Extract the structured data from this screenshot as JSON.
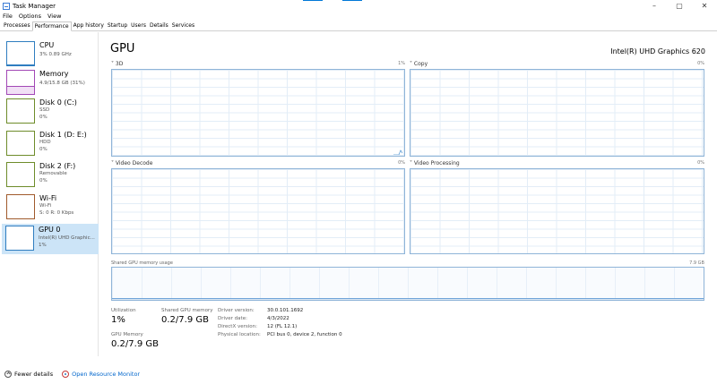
{
  "window": {
    "title": "Task Manager",
    "controls": {
      "minimize": "–",
      "maximize": "▢",
      "close": "✕"
    }
  },
  "menu": [
    "File",
    "Options",
    "View"
  ],
  "tabs": [
    {
      "label": "Processes",
      "active": false
    },
    {
      "label": "Performance",
      "active": true
    },
    {
      "label": "App history",
      "active": false
    },
    {
      "label": "Startup",
      "active": false
    },
    {
      "label": "Users",
      "active": false
    },
    {
      "label": "Details",
      "active": false
    },
    {
      "label": "Services",
      "active": false
    }
  ],
  "sidebar": {
    "items": [
      {
        "title": "CPU",
        "lines": [
          "3%  0.89 GHz"
        ]
      },
      {
        "title": "Memory",
        "lines": [
          "4.9/15.8 GB (31%)"
        ]
      },
      {
        "title": "Disk 0 (C:)",
        "lines": [
          "SSD",
          "0%"
        ]
      },
      {
        "title": "Disk 1 (D: E:)",
        "lines": [
          "HDD",
          "0%"
        ]
      },
      {
        "title": "Disk 2 (F:)",
        "lines": [
          "Removable",
          "0%"
        ]
      },
      {
        "title": "Wi-Fi",
        "lines": [
          "Wi-Fi",
          "S: 0  R: 0 Kbps"
        ]
      },
      {
        "title": "GPU 0",
        "lines": [
          "Intel(R) UHD Graphic...",
          "1%"
        ],
        "selected": true
      }
    ]
  },
  "main": {
    "title": "GPU",
    "model": "Intel(R) UHD Graphics 620",
    "graphs": [
      {
        "label": "3D",
        "right": "1%"
      },
      {
        "label": "Copy",
        "right": "0%"
      },
      {
        "label": "Video Decode",
        "right": "0%"
      },
      {
        "label": "Video Processing",
        "right": "0%"
      }
    ],
    "shared_memory": {
      "label": "Shared GPU memory usage",
      "max": "7.9 GB"
    },
    "stats": {
      "utilization": {
        "label": "Utilization",
        "value": "1%"
      },
      "shared_gpu_memory": {
        "label": "Shared GPU memory",
        "value": "0.2/7.9 GB"
      },
      "gpu_memory": {
        "label": "GPU Memory",
        "value": "0.2/7.9 GB"
      }
    },
    "info": [
      {
        "key": "Driver version:",
        "value": "30.0.101.1692"
      },
      {
        "key": "Driver date:",
        "value": "4/3/2022"
      },
      {
        "key": "DirectX version:",
        "value": "12 (FL 12.1)"
      },
      {
        "key": "Physical location:",
        "value": "PCI bus 0, device 2, function 0"
      }
    ]
  },
  "footer": {
    "fewer_details": "Fewer details",
    "open_resource_monitor": "Open Resource Monitor"
  },
  "colors": {
    "accent": "#0078d7",
    "selected_bg": "#cce4f7",
    "graph_border": "#8fb4d8",
    "link": "#0066cc"
  }
}
